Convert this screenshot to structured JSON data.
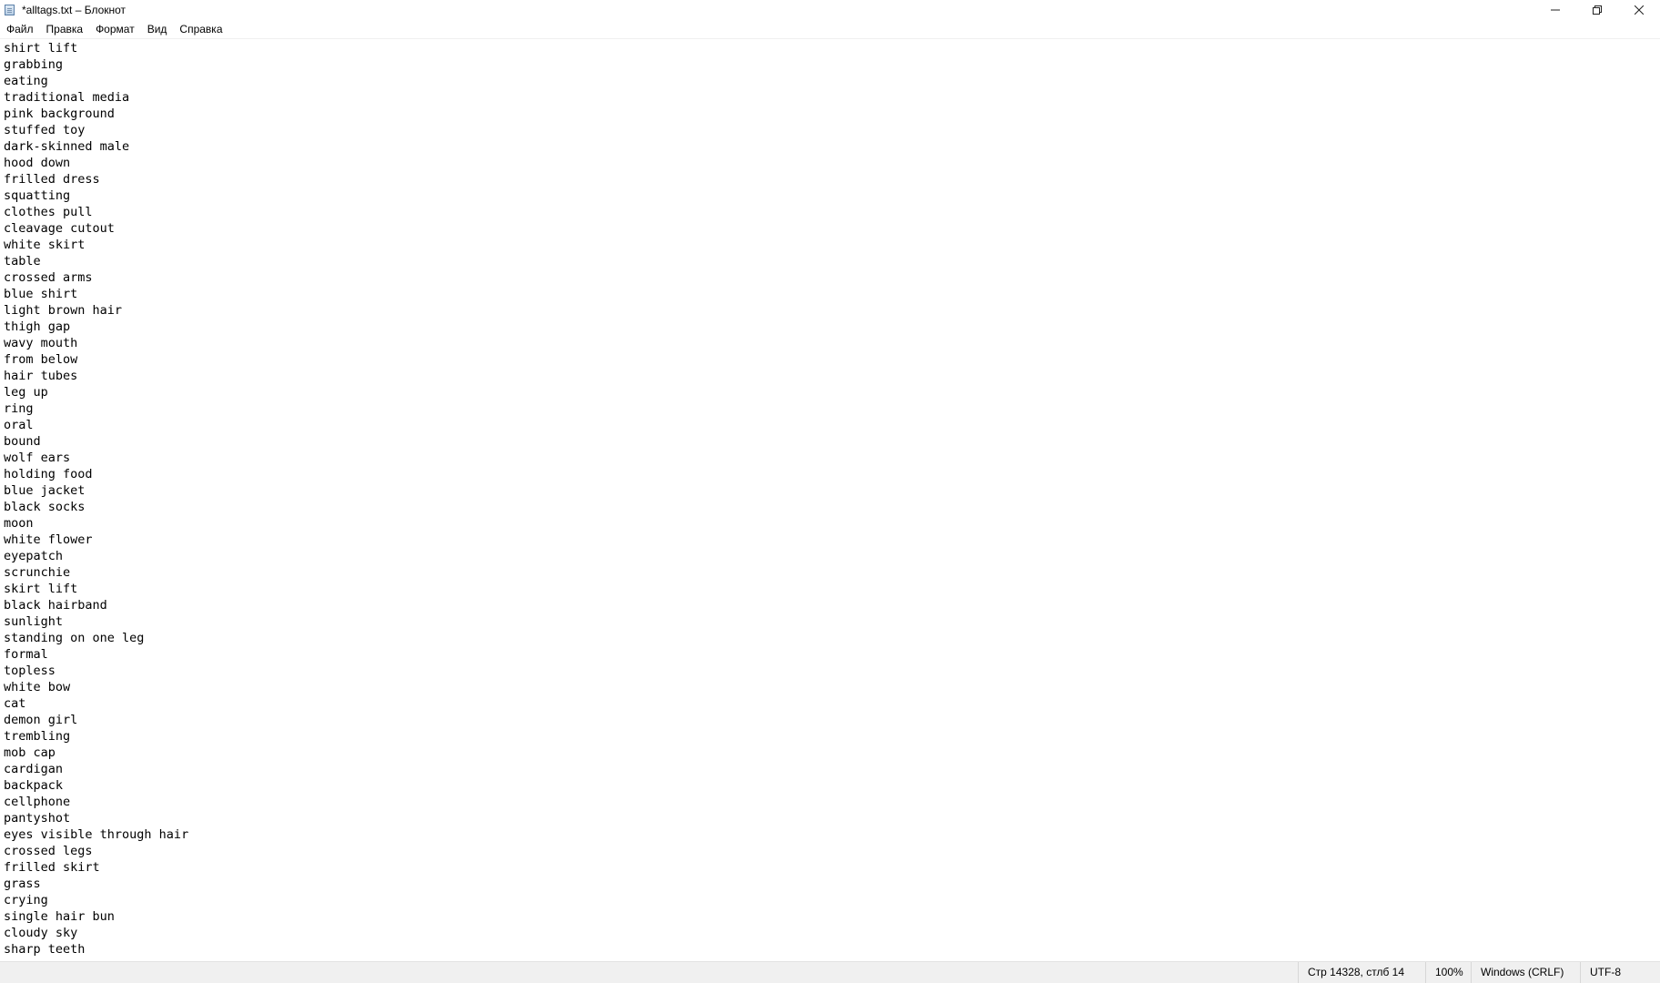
{
  "window": {
    "title": "*alltags.txt – Блокнот"
  },
  "menu": {
    "items": [
      {
        "label": "Файл"
      },
      {
        "label": "Правка"
      },
      {
        "label": "Формат"
      },
      {
        "label": "Вид"
      },
      {
        "label": "Справка"
      }
    ]
  },
  "editor": {
    "lines": [
      "shirt lift",
      "grabbing",
      "eating",
      "traditional media",
      "pink background",
      "stuffed toy",
      "dark-skinned male",
      "hood down",
      "frilled dress",
      "squatting",
      "clothes pull",
      "cleavage cutout",
      "white skirt",
      "table",
      "crossed arms",
      "blue shirt",
      "light brown hair",
      "thigh gap",
      "wavy mouth",
      "from below",
      "hair tubes",
      "leg up",
      "ring",
      "oral",
      "bound",
      "wolf ears",
      "holding food",
      "blue jacket",
      "black socks",
      "moon",
      "white flower",
      "eyepatch",
      "scrunchie",
      "skirt lift",
      "black hairband",
      "sunlight",
      "standing on one leg",
      "formal",
      "topless",
      "white bow",
      "cat",
      "demon girl",
      "trembling",
      "mob cap",
      "cardigan",
      "backpack",
      "cellphone",
      "pantyshot",
      "eyes visible through hair",
      "crossed legs",
      "frilled skirt",
      "grass",
      "crying",
      "single hair bun",
      "cloudy sky",
      "sharp teeth"
    ]
  },
  "status": {
    "position": "Стр 14328, стлб 14",
    "zoom": "100%",
    "line_endings": "Windows (CRLF)",
    "encoding": "UTF-8"
  }
}
